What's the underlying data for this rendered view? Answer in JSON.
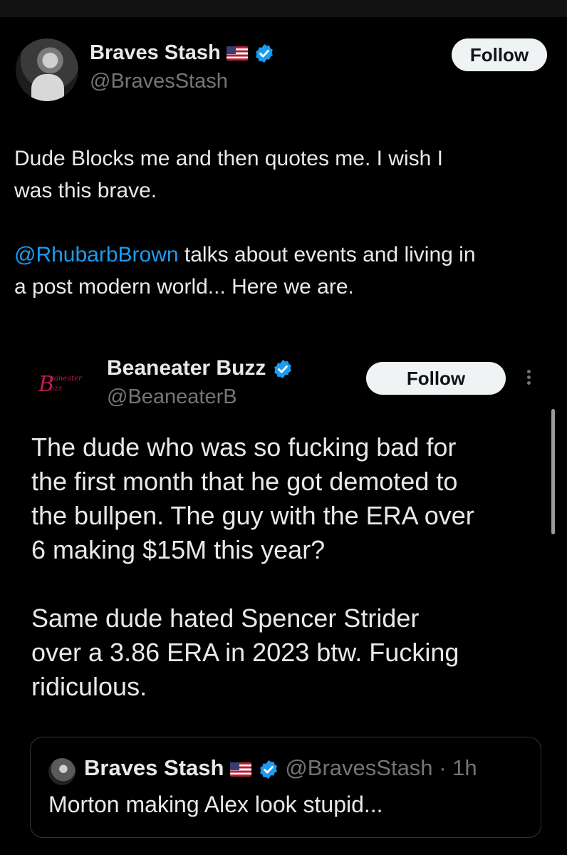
{
  "tweet": {
    "author": {
      "name": "Braves Stash",
      "handle": "@BravesStash"
    },
    "follow_label": "Follow",
    "text_line1": "Dude Blocks me and then quotes me. I wish I",
    "text_line2": "was this brave.",
    "mention": "@RhubarbBrown",
    "text_line3_rest": " talks about events and living in",
    "text_line4": "a post modern world... Here we are."
  },
  "quoted_tweet": {
    "author": {
      "name": "Beaneater Buzz",
      "handle": "@BeaneaterB"
    },
    "logo_text": {
      "big": "B",
      "line1": "eaneater",
      "line2": "uzz"
    },
    "follow_label": "Follow",
    "lines": [
      "The dude who was so fucking bad for",
      "the first month that he got demoted to",
      "the bullpen. The guy with the ERA over",
      "6 making $15M this year?",
      "Same dude hated Spencer Strider",
      "over a 3.86 ERA in 2023 btw. Fucking",
      "ridiculous."
    ]
  },
  "nested_quote": {
    "name": "Braves Stash",
    "handle": "@BravesStash",
    "time": "· 1h",
    "text": "Morton making Alex look stupid..."
  },
  "colors": {
    "accent": "#1d9bf0",
    "background": "#000000",
    "text": "#e7e9ea",
    "muted": "#71767b"
  },
  "icons": [
    "us-flag-icon",
    "verified-badge-icon",
    "more-options-icon"
  ]
}
